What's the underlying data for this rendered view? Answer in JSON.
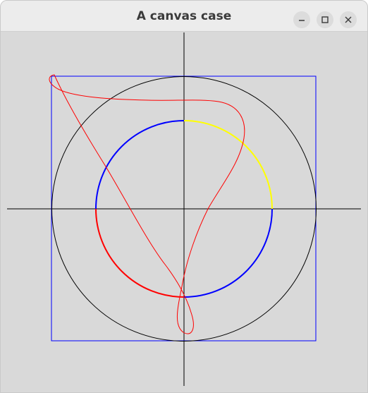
{
  "window": {
    "title": "A canvas case"
  },
  "titlebar_buttons": [
    {
      "name": "minimize",
      "icon": "minimize-icon"
    },
    {
      "name": "maximize",
      "icon": "maximize-icon"
    },
    {
      "name": "close",
      "icon": "close-icon"
    }
  ],
  "canvas": {
    "background": "#d9d9d9",
    "axes_color": "#000000",
    "outer_circle_color": "#000000",
    "square_color": "#0000ff",
    "inner_arc_colors": [
      "#ffff00",
      "#0000ff",
      "#ff0000",
      "#0000ff"
    ],
    "curve_color": "#ff0000"
  }
}
